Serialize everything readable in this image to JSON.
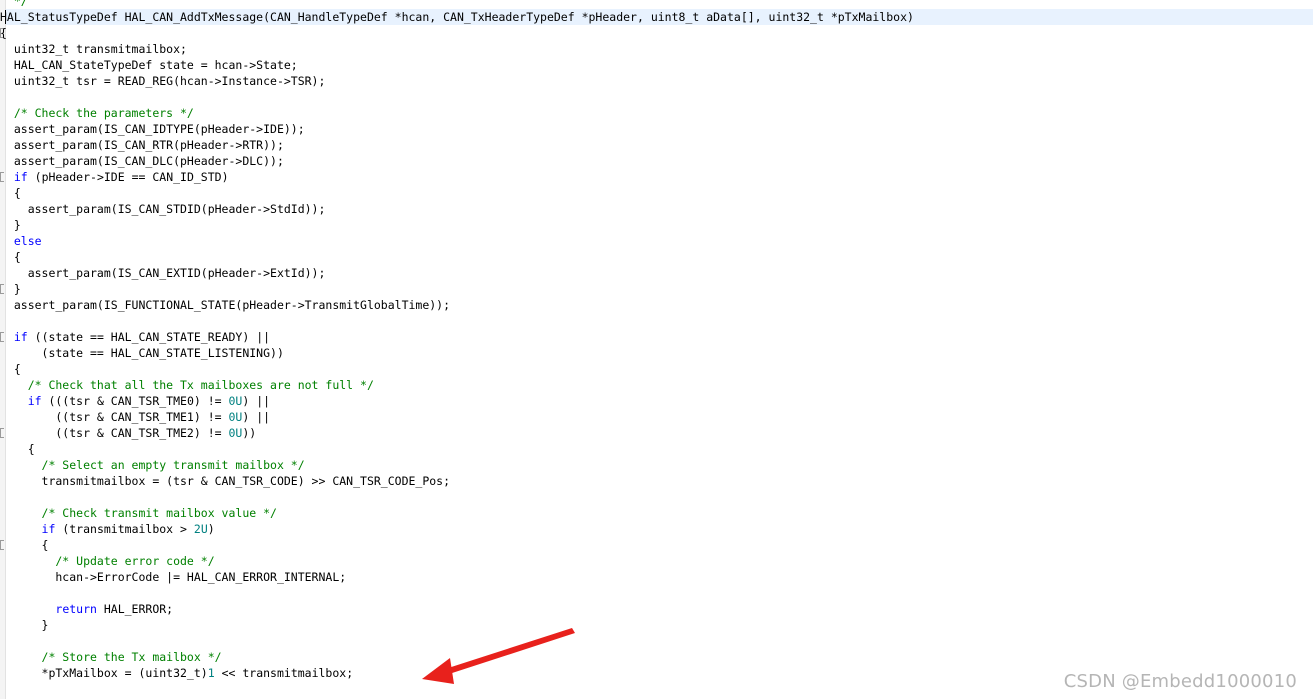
{
  "lines": [
    {
      "segs": [
        {
          "t": "  */",
          "c": "cm"
        }
      ]
    },
    {
      "segs": [
        {
          "t": "HAL_StatusTypeDef HAL_CAN_AddTxMessage(CAN_HandleTypeDef *hcan, CAN_TxHeaderTypeDef *pHeader, uint8_t aData[], uint32_t *pTxMailbox)",
          "c": ""
        }
      ]
    },
    {
      "segs": [
        {
          "t": "{",
          "c": ""
        }
      ]
    },
    {
      "segs": [
        {
          "t": "  uint32_t transmitmailbox;",
          "c": ""
        }
      ]
    },
    {
      "segs": [
        {
          "t": "  HAL_CAN_StateTypeDef state = hcan->State;",
          "c": ""
        }
      ]
    },
    {
      "segs": [
        {
          "t": "  uint32_t tsr = READ_REG(hcan->Instance->TSR);",
          "c": ""
        }
      ]
    },
    {
      "segs": [
        {
          "t": "",
          "c": ""
        }
      ]
    },
    {
      "segs": [
        {
          "t": "  /* Check the parameters */",
          "c": "cm"
        }
      ]
    },
    {
      "segs": [
        {
          "t": "  assert_param(IS_CAN_IDTYPE(pHeader->IDE));",
          "c": ""
        }
      ]
    },
    {
      "segs": [
        {
          "t": "  assert_param(IS_CAN_RTR(pHeader->RTR));",
          "c": ""
        }
      ]
    },
    {
      "segs": [
        {
          "t": "  assert_param(IS_CAN_DLC(pHeader->DLC));",
          "c": ""
        }
      ]
    },
    {
      "segs": [
        {
          "t": "  ",
          "c": ""
        },
        {
          "t": "if",
          "c": "kw"
        },
        {
          "t": " (pHeader->IDE == CAN_ID_STD)",
          "c": ""
        }
      ]
    },
    {
      "segs": [
        {
          "t": "  {",
          "c": ""
        }
      ]
    },
    {
      "segs": [
        {
          "t": "    assert_param(IS_CAN_STDID(pHeader->StdId));",
          "c": ""
        }
      ]
    },
    {
      "segs": [
        {
          "t": "  }",
          "c": ""
        }
      ]
    },
    {
      "segs": [
        {
          "t": "  ",
          "c": ""
        },
        {
          "t": "else",
          "c": "kw"
        }
      ]
    },
    {
      "segs": [
        {
          "t": "  {",
          "c": ""
        }
      ]
    },
    {
      "segs": [
        {
          "t": "    assert_param(IS_CAN_EXTID(pHeader->ExtId));",
          "c": ""
        }
      ]
    },
    {
      "segs": [
        {
          "t": "  }",
          "c": ""
        }
      ]
    },
    {
      "segs": [
        {
          "t": "  assert_param(IS_FUNCTIONAL_STATE(pHeader->TransmitGlobalTime));",
          "c": ""
        }
      ]
    },
    {
      "segs": [
        {
          "t": "",
          "c": ""
        }
      ]
    },
    {
      "segs": [
        {
          "t": "  ",
          "c": ""
        },
        {
          "t": "if",
          "c": "kw"
        },
        {
          "t": " ((state == HAL_CAN_STATE_READY) ||",
          "c": ""
        }
      ]
    },
    {
      "segs": [
        {
          "t": "      (state == HAL_CAN_STATE_LISTENING))",
          "c": ""
        }
      ]
    },
    {
      "segs": [
        {
          "t": "  {",
          "c": ""
        }
      ]
    },
    {
      "segs": [
        {
          "t": "    /* Check that all the Tx mailboxes are not full */",
          "c": "cm"
        }
      ]
    },
    {
      "segs": [
        {
          "t": "    ",
          "c": ""
        },
        {
          "t": "if",
          "c": "kw"
        },
        {
          "t": " (((tsr & CAN_TSR_TME0) != ",
          "c": ""
        },
        {
          "t": "0U",
          "c": "num"
        },
        {
          "t": ") ||",
          "c": ""
        }
      ]
    },
    {
      "segs": [
        {
          "t": "        ((tsr & CAN_TSR_TME1) != ",
          "c": ""
        },
        {
          "t": "0U",
          "c": "num"
        },
        {
          "t": ") ||",
          "c": ""
        }
      ]
    },
    {
      "segs": [
        {
          "t": "        ((tsr & CAN_TSR_TME2) != ",
          "c": ""
        },
        {
          "t": "0U",
          "c": "num"
        },
        {
          "t": "))",
          "c": ""
        }
      ]
    },
    {
      "segs": [
        {
          "t": "    {",
          "c": ""
        }
      ]
    },
    {
      "segs": [
        {
          "t": "      /* Select an empty transmit mailbox */",
          "c": "cm"
        }
      ]
    },
    {
      "segs": [
        {
          "t": "      transmitmailbox = (tsr & CAN_TSR_CODE) >> CAN_TSR_CODE_Pos;",
          "c": ""
        }
      ]
    },
    {
      "segs": [
        {
          "t": "",
          "c": ""
        }
      ]
    },
    {
      "segs": [
        {
          "t": "      /* Check transmit mailbox value */",
          "c": "cm"
        }
      ]
    },
    {
      "segs": [
        {
          "t": "      ",
          "c": ""
        },
        {
          "t": "if",
          "c": "kw"
        },
        {
          "t": " (transmitmailbox > ",
          "c": ""
        },
        {
          "t": "2U",
          "c": "num"
        },
        {
          "t": ")",
          "c": ""
        }
      ]
    },
    {
      "segs": [
        {
          "t": "      {",
          "c": ""
        }
      ]
    },
    {
      "segs": [
        {
          "t": "        /* Update error code */",
          "c": "cm"
        }
      ]
    },
    {
      "segs": [
        {
          "t": "        hcan->ErrorCode |= HAL_CAN_ERROR_INTERNAL;",
          "c": ""
        }
      ]
    },
    {
      "segs": [
        {
          "t": "",
          "c": ""
        }
      ]
    },
    {
      "segs": [
        {
          "t": "        ",
          "c": ""
        },
        {
          "t": "return",
          "c": "kw"
        },
        {
          "t": " HAL_ERROR;",
          "c": ""
        }
      ]
    },
    {
      "segs": [
        {
          "t": "      }",
          "c": ""
        }
      ]
    },
    {
      "segs": [
        {
          "t": "",
          "c": ""
        }
      ]
    },
    {
      "segs": [
        {
          "t": "      /* Store the Tx mailbox */",
          "c": "cm"
        }
      ]
    },
    {
      "segs": [
        {
          "t": "      *pTxMailbox = (uint32_t)",
          "c": ""
        },
        {
          "t": "1",
          "c": "num"
        },
        {
          "t": " << transmitmailbox;",
          "c": ""
        }
      ]
    }
  ],
  "watermark": "CSDN @Embedd1000010",
  "colors": {
    "keyword": "#0000ff",
    "comment": "#008000",
    "number": "#008080",
    "current_line": "#e8f2fe",
    "annotation_arrow": "#e8211c"
  }
}
